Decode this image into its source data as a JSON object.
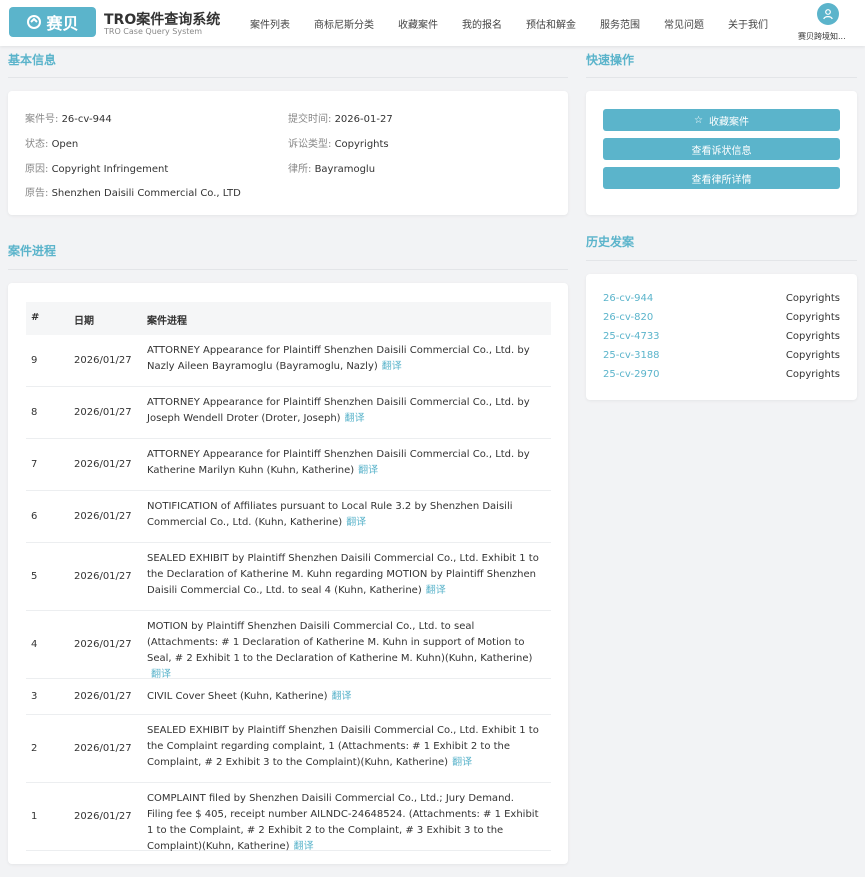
{
  "header": {
    "logo_text": "赛贝",
    "title": "TRO案件查询系统",
    "subtitle": "TRO Case Query System",
    "nav": [
      "案件列表",
      "商标尼斯分类",
      "收藏案件",
      "我的报名",
      "预估和解金",
      "服务范围",
      "常见问题",
      "关于我们"
    ],
    "user_name": "赛贝跨境知..."
  },
  "basic_info": {
    "title": "基本信息",
    "case_no_label": "案件号:",
    "case_no": "26-cv-944",
    "submit_label": "提交时间:",
    "submit_time": "2026-01-27",
    "status_label": "状态:",
    "status": "Open",
    "lawsuit_type_label": "诉讼类型:",
    "lawsuit_type": "Copyrights",
    "cause_label": "原因:",
    "cause": "Copyright Infringement",
    "law_firm_label": "律所:",
    "law_firm": "Bayramoglu",
    "plaintiff_label": "原告:",
    "plaintiff": "Shenzhen Daisili Commercial Co., LTD"
  },
  "quick_actions": {
    "title": "快速操作",
    "favorite": "收藏案件",
    "view_complaint": "查看诉状信息",
    "view_firm": "查看律所详情"
  },
  "history": {
    "title": "历史发案",
    "items": [
      {
        "case": "26-cv-944",
        "type": "Copyrights"
      },
      {
        "case": "26-cv-820",
        "type": "Copyrights"
      },
      {
        "case": "25-cv-4733",
        "type": "Copyrights"
      },
      {
        "case": "25-cv-3188",
        "type": "Copyrights"
      },
      {
        "case": "25-cv-2970",
        "type": "Copyrights"
      }
    ]
  },
  "progress": {
    "title": "案件进程",
    "headers": {
      "num": "#",
      "date": "日期",
      "progress": "案件进程"
    },
    "translate_label": "翻译",
    "rows": [
      {
        "num": "9",
        "date": "2026/01/27",
        "text": "ATTORNEY Appearance for Plaintiff Shenzhen Daisili Commercial Co., Ltd. by Nazly Aileen Bayramoglu (Bayramoglu, Nazly)"
      },
      {
        "num": "8",
        "date": "2026/01/27",
        "text": "ATTORNEY Appearance for Plaintiff Shenzhen Daisili Commercial Co., Ltd. by Joseph Wendell Droter (Droter, Joseph)"
      },
      {
        "num": "7",
        "date": "2026/01/27",
        "text": "ATTORNEY Appearance for Plaintiff Shenzhen Daisili Commercial Co., Ltd. by Katherine Marilyn Kuhn (Kuhn, Katherine)"
      },
      {
        "num": "6",
        "date": "2026/01/27",
        "text": "NOTIFICATION of Affiliates pursuant to Local Rule 3.2 by Shenzhen Daisili Commercial Co., Ltd. (Kuhn, Katherine)"
      },
      {
        "num": "5",
        "date": "2026/01/27",
        "text": "SEALED EXHIBIT by Plaintiff Shenzhen Daisili Commercial Co., Ltd. Exhibit 1 to the Declaration of Katherine M. Kuhn regarding MOTION by Plaintiff Shenzhen Daisili Commercial Co., Ltd. to seal 4 (Kuhn, Katherine)"
      },
      {
        "num": "4",
        "date": "2026/01/27",
        "text": "MOTION by Plaintiff Shenzhen Daisili Commercial Co., Ltd. to seal (Attachments: # 1 Declaration of Katherine M. Kuhn in support of Motion to Seal, # 2 Exhibit 1 to the Declaration of Katherine M. Kuhn)(Kuhn, Katherine)"
      },
      {
        "num": "3",
        "date": "2026/01/27",
        "text": "CIVIL Cover Sheet (Kuhn, Katherine)"
      },
      {
        "num": "2",
        "date": "2026/01/27",
        "text": "SEALED EXHIBIT by Plaintiff Shenzhen Daisili Commercial Co., Ltd. Exhibit 1 to the Complaint regarding complaint, 1 (Attachments: # 1 Exhibit 2 to the Complaint, # 2 Exhibit 3 to the Complaint)(Kuhn, Katherine)"
      },
      {
        "num": "1",
        "date": "2026/01/27",
        "text": "COMPLAINT filed by Shenzhen Daisili Commercial Co., Ltd.; Jury Demand. Filing fee $ 405, receipt number AILNDC-24648524. (Attachments: # 1 Exhibit 1 to the Complaint, # 2 Exhibit 2 to the Complaint, # 3 Exhibit 3 to the Complaint)(Kuhn, Katherine)"
      }
    ]
  },
  "colors": {
    "accent": "#5bb4cb",
    "background": "#f2f3f5"
  }
}
